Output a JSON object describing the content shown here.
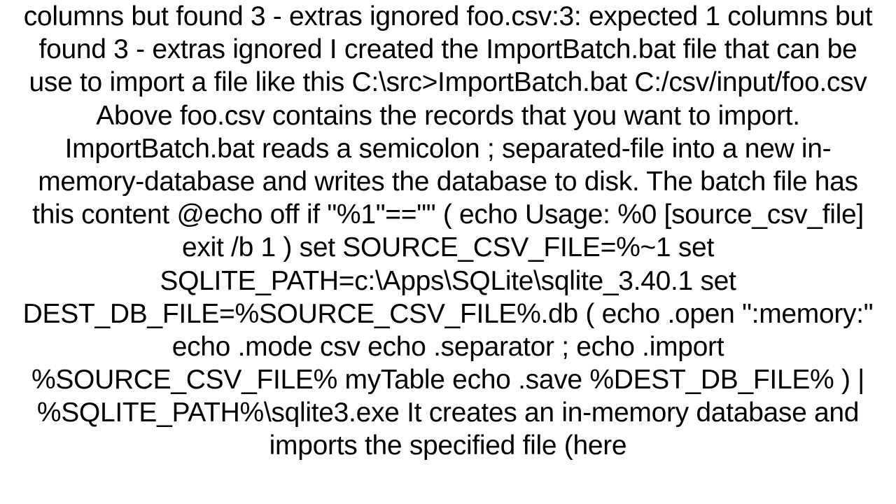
{
  "document": {
    "body_text": "columns but found 3 - extras ignored foo.csv:3: expected 1 columns but found 3 - extras ignored  I created  the ImportBatch.bat file that can be use to import a file like this C:\\src>ImportBatch.bat C:/csv/input/foo.csv  Above foo.csv contains the records that you want to import. ImportBatch.bat reads a semicolon ; separated-file  into a new in-memory-database and writes the database to disk. The batch file has this content @echo off  if \"%1\"==\"\" (     echo Usage: %0 [source_csv_file]     exit /b 1 )  set SOURCE_CSV_FILE=%~1 set SQLITE_PATH=c:\\Apps\\SQLite\\sqlite_3.40.1 set DEST_DB_FILE=%SOURCE_CSV_FILE%.db   (        echo .open \":memory:\"     echo .mode csv     echo .separator ;     echo .import %SOURCE_CSV_FILE% myTable     echo .save %DEST_DB_FILE% ) | %SQLITE_PATH%\\sqlite3.exe  It  creates an in-memory database and imports the specified file (here"
  }
}
